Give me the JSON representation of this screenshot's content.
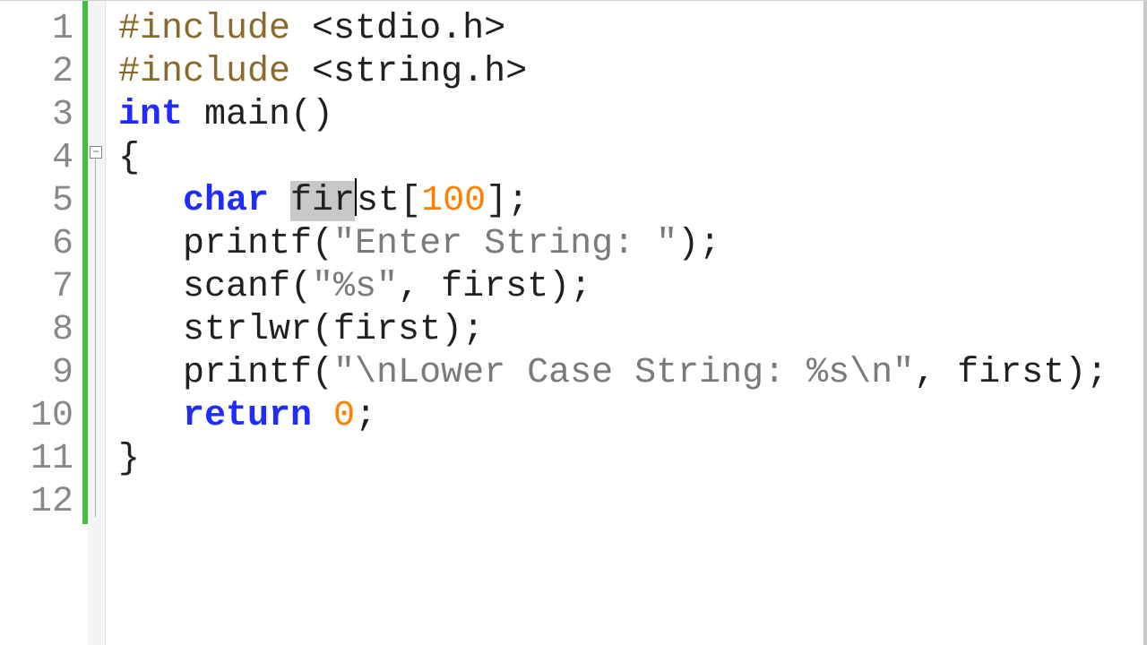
{
  "line_numbers": [
    "1",
    "2",
    "3",
    "4",
    "5",
    "6",
    "7",
    "8",
    "9",
    "10",
    "11",
    "12"
  ],
  "fold": {
    "symbol": "−"
  },
  "code": {
    "l1": {
      "directive": "#include ",
      "file": "<stdio.h>"
    },
    "l2": {
      "directive": "#include ",
      "file": "<string.h>"
    },
    "l3": {
      "kw_int": "int",
      "sp": " ",
      "main": "main",
      "parens": "()"
    },
    "l4": {
      "brace": "{"
    },
    "l5": {
      "kw_char": "char",
      "sp": " ",
      "sel_part": "fir",
      "rest_ident": "st",
      "lbrack": "[",
      "num": "100",
      "rbrack": "]",
      "semi": ";"
    },
    "l6": {
      "fn": "printf",
      "open": "(",
      "str": "\"Enter String: \"",
      "close": ")",
      "semi": ";"
    },
    "l7": {
      "fn": "scanf",
      "open": "(",
      "str": "\"%s\"",
      "comma": ", ",
      "arg": "first",
      "close": ")",
      "semi": ";"
    },
    "l8": {
      "fn": "strlwr",
      "open": "(",
      "arg": "first",
      "close": ")",
      "semi": ";"
    },
    "l9": {
      "fn": "printf",
      "open": "(",
      "str": "\"\\nLower Case String: %s\\n\"",
      "comma": ", ",
      "arg": "first",
      "close": ")",
      "semi": ";"
    },
    "l10": {
      "kw_return": "return",
      "sp": " ",
      "num": "0",
      "semi": ";"
    },
    "l11": {
      "brace": "}"
    },
    "l12": {
      "blank": ""
    }
  }
}
